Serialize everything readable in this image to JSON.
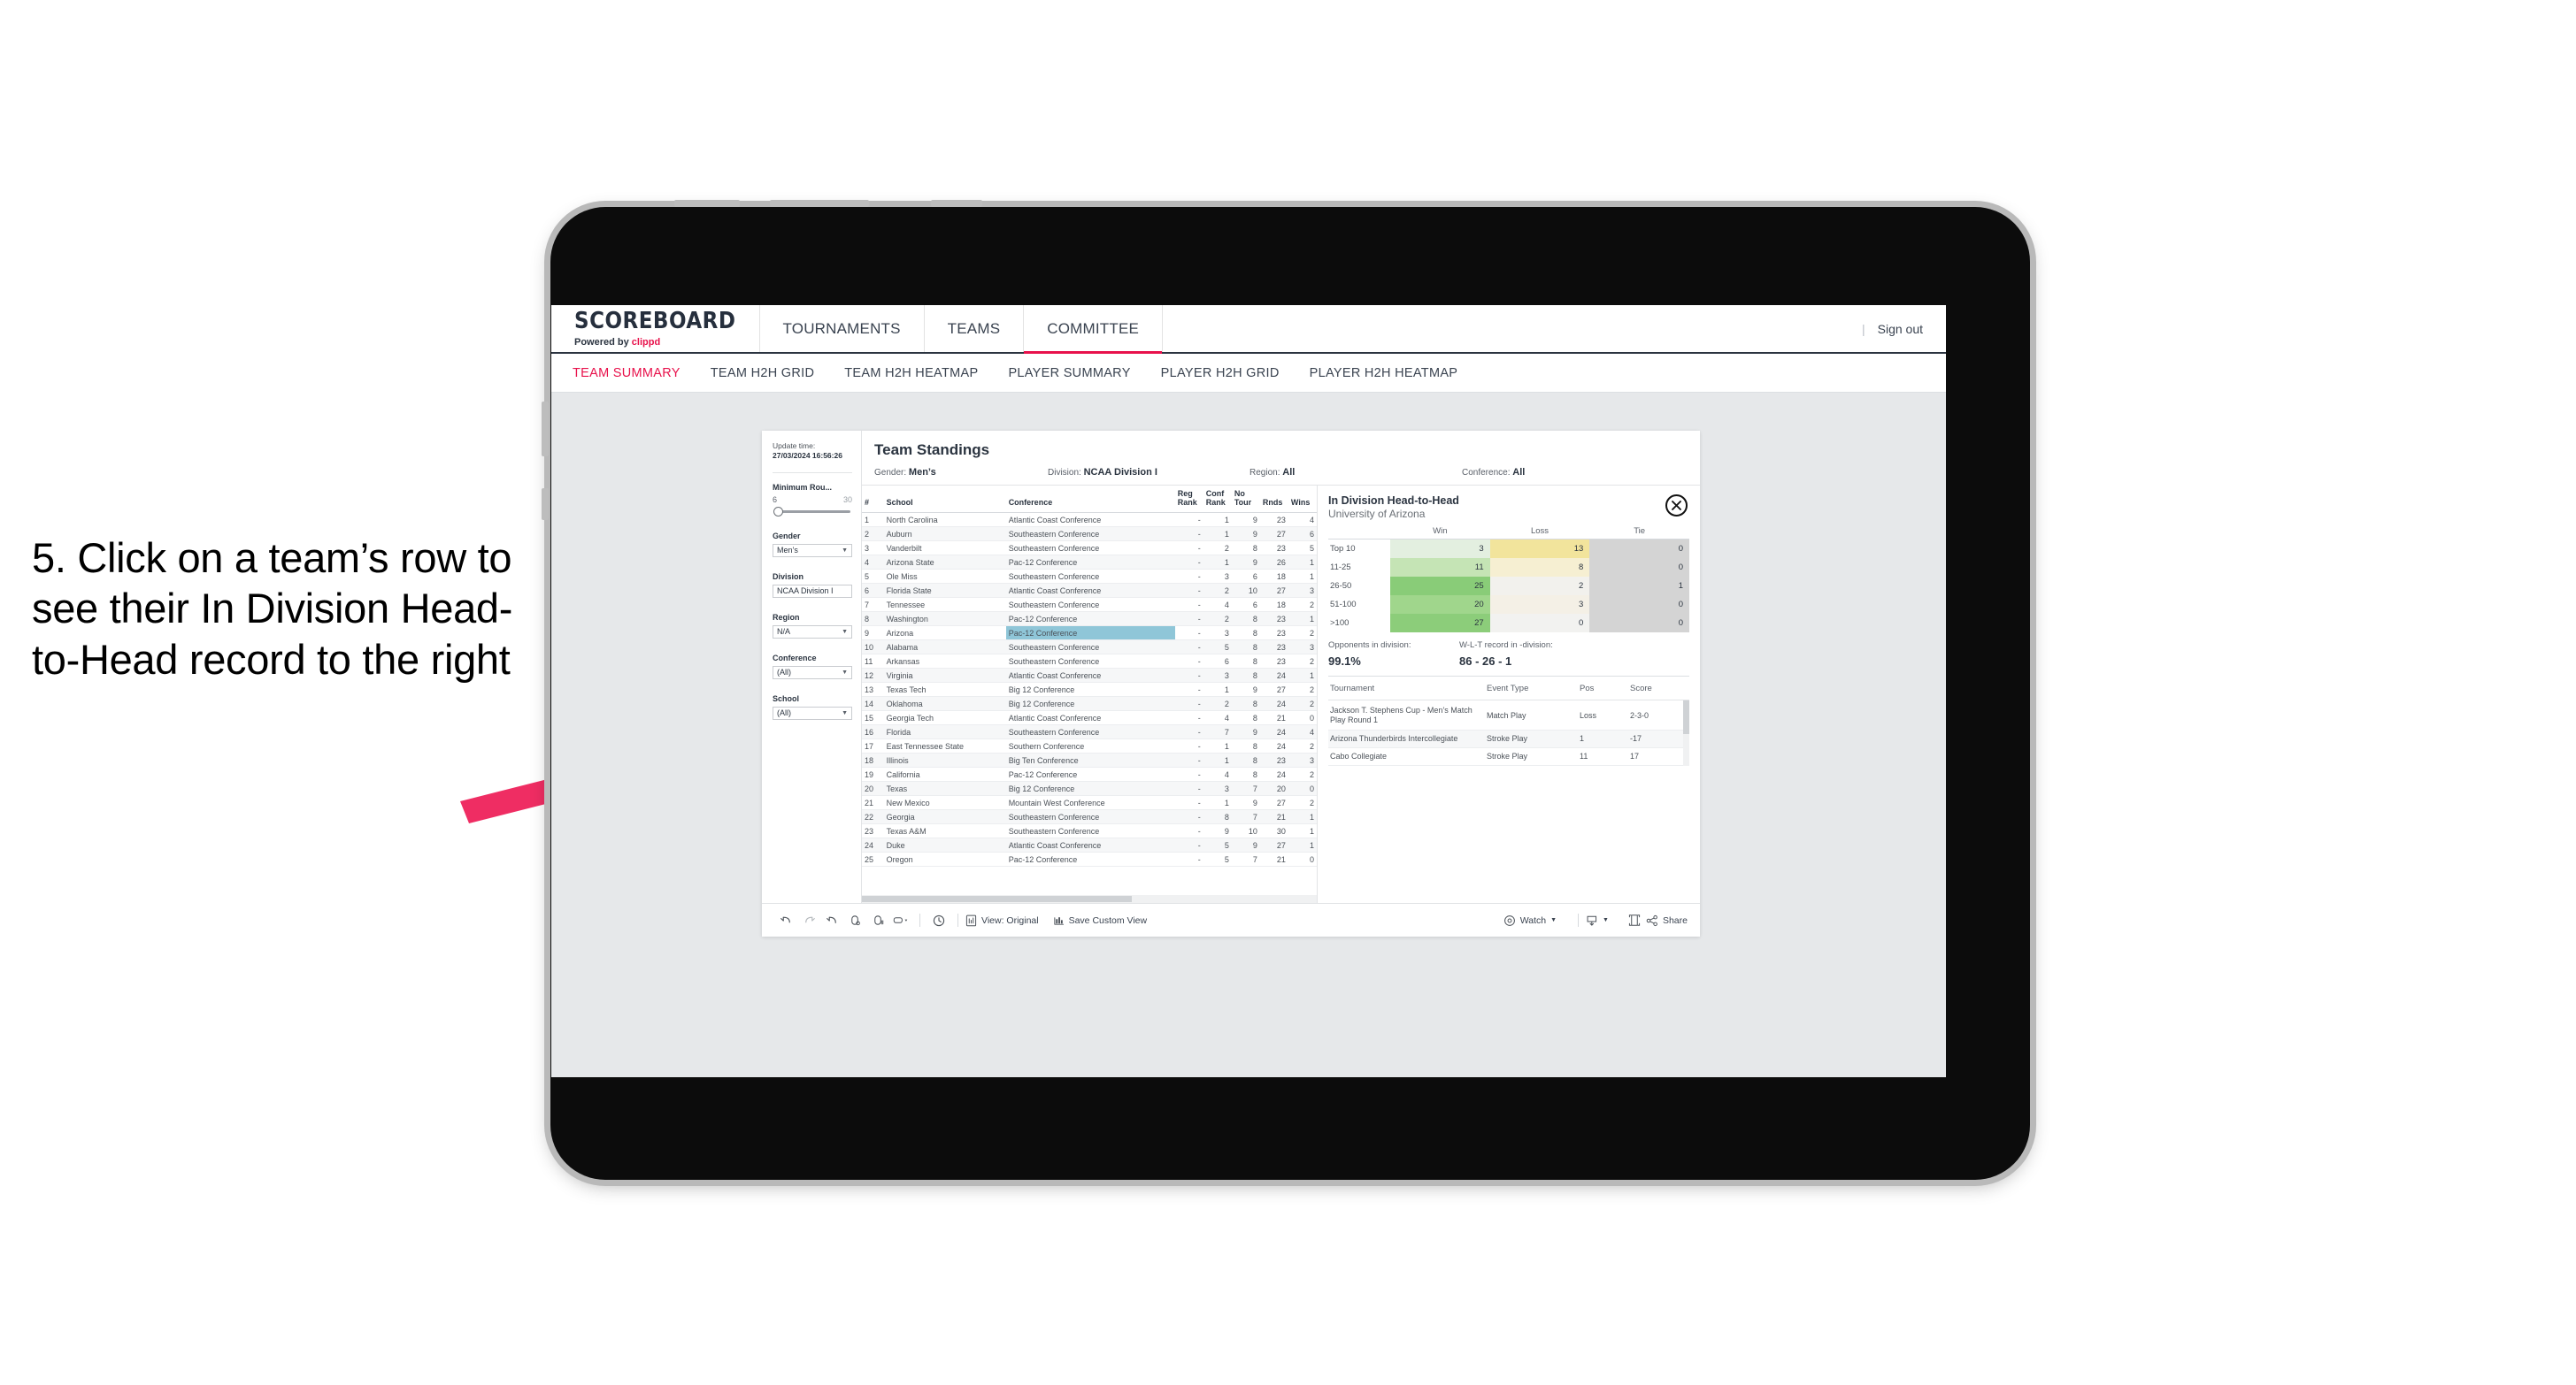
{
  "annotation": {
    "text": "5. Click on a team’s row to see their In Division Head-to-Head record to the right",
    "arrow_color": "#ef2d63"
  },
  "app": {
    "brand": {
      "title": "SCOREBOARD",
      "powered_prefix": "Powered by ",
      "powered_brand": "clippd"
    },
    "top_nav": [
      {
        "label": "TOURNAMENTS",
        "active": false
      },
      {
        "label": "TEAMS",
        "active": false
      },
      {
        "label": "COMMITTEE",
        "active": true
      }
    ],
    "sign_out": "Sign out",
    "tabs": [
      {
        "label": "TEAM SUMMARY",
        "active": true
      },
      {
        "label": "TEAM H2H GRID",
        "active": false
      },
      {
        "label": "TEAM H2H HEATMAP",
        "active": false
      },
      {
        "label": "PLAYER SUMMARY",
        "active": false
      },
      {
        "label": "PLAYER H2H GRID",
        "active": false
      },
      {
        "label": "PLAYER H2H HEATMAP",
        "active": false
      }
    ]
  },
  "rail": {
    "update_label": "Update time:",
    "update_value": "27/03/2024 16:56:26",
    "slider": {
      "label": "Minimum Rou...",
      "min": "6",
      "max": "30"
    },
    "filters": [
      {
        "label": "Gender",
        "value": "Men’s"
      },
      {
        "label": "Division",
        "value": "NCAA Division I"
      },
      {
        "label": "Region",
        "value": "N/A"
      },
      {
        "label": "Conference",
        "value": "(All)"
      },
      {
        "label": "School",
        "value": "(All)"
      }
    ]
  },
  "standings": {
    "title": "Team Standings",
    "filter_summary": [
      {
        "label": "Gender:",
        "value": "Men’s"
      },
      {
        "label": "Division:",
        "value": "NCAA Division I"
      },
      {
        "label": "Region:",
        "value": "All"
      },
      {
        "label": "Conference:",
        "value": "All"
      }
    ],
    "columns": [
      "#",
      "School",
      "Conference",
      "Reg Rank",
      "Conf Rank",
      "No Tour",
      "Rnds",
      "Wins"
    ],
    "rows": [
      {
        "n": "1",
        "school": "North Carolina",
        "conf": "Atlantic Coast Conference",
        "reg": "-",
        "confrank": "1",
        "notour": "9",
        "rnds": "23",
        "wins": "4"
      },
      {
        "n": "2",
        "school": "Auburn",
        "conf": "Southeastern Conference",
        "reg": "-",
        "confrank": "1",
        "notour": "9",
        "rnds": "27",
        "wins": "6"
      },
      {
        "n": "3",
        "school": "Vanderbilt",
        "conf": "Southeastern Conference",
        "reg": "-",
        "confrank": "2",
        "notour": "8",
        "rnds": "23",
        "wins": "5"
      },
      {
        "n": "4",
        "school": "Arizona State",
        "conf": "Pac-12 Conference",
        "reg": "-",
        "confrank": "1",
        "notour": "9",
        "rnds": "26",
        "wins": "1"
      },
      {
        "n": "5",
        "school": "Ole Miss",
        "conf": "Southeastern Conference",
        "reg": "-",
        "confrank": "3",
        "notour": "6",
        "rnds": "18",
        "wins": "1"
      },
      {
        "n": "6",
        "school": "Florida State",
        "conf": "Atlantic Coast Conference",
        "reg": "-",
        "confrank": "2",
        "notour": "10",
        "rnds": "27",
        "wins": "3"
      },
      {
        "n": "7",
        "school": "Tennessee",
        "conf": "Southeastern Conference",
        "reg": "-",
        "confrank": "4",
        "notour": "6",
        "rnds": "18",
        "wins": "2"
      },
      {
        "n": "8",
        "school": "Washington",
        "conf": "Pac-12 Conference",
        "reg": "-",
        "confrank": "2",
        "notour": "8",
        "rnds": "23",
        "wins": "1"
      },
      {
        "n": "9",
        "school": "Arizona",
        "conf": "Pac-12 Conference",
        "reg": "-",
        "confrank": "3",
        "notour": "8",
        "rnds": "23",
        "wins": "2",
        "selected": true
      },
      {
        "n": "10",
        "school": "Alabama",
        "conf": "Southeastern Conference",
        "reg": "-",
        "confrank": "5",
        "notour": "8",
        "rnds": "23",
        "wins": "3"
      },
      {
        "n": "11",
        "school": "Arkansas",
        "conf": "Southeastern Conference",
        "reg": "-",
        "confrank": "6",
        "notour": "8",
        "rnds": "23",
        "wins": "2"
      },
      {
        "n": "12",
        "school": "Virginia",
        "conf": "Atlantic Coast Conference",
        "reg": "-",
        "confrank": "3",
        "notour": "8",
        "rnds": "24",
        "wins": "1"
      },
      {
        "n": "13",
        "school": "Texas Tech",
        "conf": "Big 12 Conference",
        "reg": "-",
        "confrank": "1",
        "notour": "9",
        "rnds": "27",
        "wins": "2"
      },
      {
        "n": "14",
        "school": "Oklahoma",
        "conf": "Big 12 Conference",
        "reg": "-",
        "confrank": "2",
        "notour": "8",
        "rnds": "24",
        "wins": "2"
      },
      {
        "n": "15",
        "school": "Georgia Tech",
        "conf": "Atlantic Coast Conference",
        "reg": "-",
        "confrank": "4",
        "notour": "8",
        "rnds": "21",
        "wins": "0"
      },
      {
        "n": "16",
        "school": "Florida",
        "conf": "Southeastern Conference",
        "reg": "-",
        "confrank": "7",
        "notour": "9",
        "rnds": "24",
        "wins": "4"
      },
      {
        "n": "17",
        "school": "East Tennessee State",
        "conf": "Southern Conference",
        "reg": "-",
        "confrank": "1",
        "notour": "8",
        "rnds": "24",
        "wins": "2"
      },
      {
        "n": "18",
        "school": "Illinois",
        "conf": "Big Ten Conference",
        "reg": "-",
        "confrank": "1",
        "notour": "8",
        "rnds": "23",
        "wins": "3"
      },
      {
        "n": "19",
        "school": "California",
        "conf": "Pac-12 Conference",
        "reg": "-",
        "confrank": "4",
        "notour": "8",
        "rnds": "24",
        "wins": "2"
      },
      {
        "n": "20",
        "school": "Texas",
        "conf": "Big 12 Conference",
        "reg": "-",
        "confrank": "3",
        "notour": "7",
        "rnds": "20",
        "wins": "0"
      },
      {
        "n": "21",
        "school": "New Mexico",
        "conf": "Mountain West Conference",
        "reg": "-",
        "confrank": "1",
        "notour": "9",
        "rnds": "27",
        "wins": "2"
      },
      {
        "n": "22",
        "school": "Georgia",
        "conf": "Southeastern Conference",
        "reg": "-",
        "confrank": "8",
        "notour": "7",
        "rnds": "21",
        "wins": "1"
      },
      {
        "n": "23",
        "school": "Texas A&M",
        "conf": "Southeastern Conference",
        "reg": "-",
        "confrank": "9",
        "notour": "10",
        "rnds": "30",
        "wins": "1"
      },
      {
        "n": "24",
        "school": "Duke",
        "conf": "Atlantic Coast Conference",
        "reg": "-",
        "confrank": "5",
        "notour": "9",
        "rnds": "27",
        "wins": "1"
      },
      {
        "n": "25",
        "school": "Oregon",
        "conf": "Pac-12 Conference",
        "reg": "-",
        "confrank": "5",
        "notour": "7",
        "rnds": "21",
        "wins": "0"
      }
    ]
  },
  "h2h": {
    "title": "In Division Head-to-Head",
    "subtitle": "University of Arizona",
    "close_icon": "close-icon",
    "matrix_columns": [
      "Win",
      "Loss",
      "Tie"
    ],
    "matrix_rows": [
      {
        "label": "Top 10",
        "win": "3",
        "loss": "13",
        "tie": "0",
        "win_color": "#e3efe0",
        "loss_color": "#f2e49c",
        "tie_color": "#d4d4d4"
      },
      {
        "label": "11-25",
        "win": "11",
        "loss": "8",
        "tie": "0",
        "win_color": "#c5e4b5",
        "loss_color": "#f6efd2",
        "tie_color": "#d4d4d4"
      },
      {
        "label": "26-50",
        "win": "25",
        "loss": "2",
        "tie": "1",
        "win_color": "#89cc78",
        "loss_color": "#f2f1ed",
        "tie_color": "#d4d4d4"
      },
      {
        "label": "51-100",
        "win": "20",
        "loss": "3",
        "tie": "0",
        "win_color": "#a0d68c",
        "loss_color": "#f4f0e6",
        "tie_color": "#d4d4d4"
      },
      {
        "label": ">100",
        "win": "27",
        "loss": "0",
        "tie": "0",
        "win_color": "#8ccd7a",
        "loss_color": "#f2f2f0",
        "tie_color": "#d4d4d4"
      }
    ],
    "stats": [
      {
        "label": "Opponents in division:",
        "value": "99.1%"
      },
      {
        "label": "W-L-T record in -division:",
        "value": "86 - 26 - 1"
      }
    ],
    "tourn_columns": [
      "Tournament",
      "Event Type",
      "Pos",
      "Score"
    ],
    "tournaments": [
      {
        "name": "Jackson T. Stephens Cup - Men’s Match Play Round 1",
        "type": "Match Play",
        "pos": "Loss",
        "score": "2-3-0"
      },
      {
        "name": "Arizona Thunderbirds Intercollegiate",
        "type": "Stroke Play",
        "pos": "1",
        "score": "-17"
      },
      {
        "name": "Cabo Collegiate",
        "type": "Stroke Play",
        "pos": "11",
        "score": "17"
      }
    ]
  },
  "toolbar": {
    "icons": [
      "undo-icon",
      "redo-icon",
      "revert-icon",
      "refresh-data-icon",
      "pause-updates-icon",
      "highlight-icon"
    ],
    "alert_icon": "alerts-icon",
    "view_label": "View: Original",
    "view_icon": "view-original-icon",
    "save_label": "Save Custom View",
    "save_icon": "save-view-icon",
    "watch_label": "Watch",
    "watch_icon": "watch-icon",
    "download_icon": "download-icon",
    "device_icon": "device-layout-icon",
    "share_label": "Share",
    "share_icon": "share-icon"
  }
}
